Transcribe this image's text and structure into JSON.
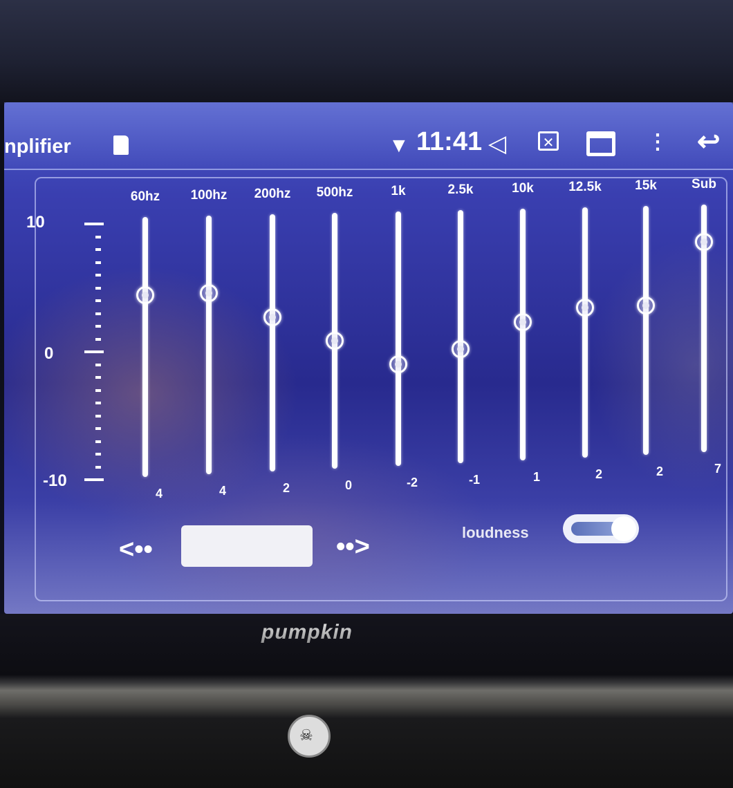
{
  "status_bar": {
    "app_title": "nplifier",
    "clock": "11:41"
  },
  "equalizer": {
    "scale": {
      "max": "10",
      "mid": "0",
      "min": "-10"
    },
    "range": [
      -10,
      10
    ],
    "bands": [
      {
        "label": "60hz",
        "value_text": "4",
        "level": 4
      },
      {
        "label": "100hz",
        "value_text": "4",
        "level": 4
      },
      {
        "label": "200hz",
        "value_text": "2",
        "level": 2
      },
      {
        "label": "500hz",
        "value_text": "0",
        "level": 0
      },
      {
        "label": "1k",
        "value_text": "-2",
        "level": -2
      },
      {
        "label": "2.5k",
        "value_text": "-1",
        "level": -1
      },
      {
        "label": "10k",
        "value_text": "1",
        "level": 1
      },
      {
        "label": "12.5k",
        "value_text": "2",
        "level": 2
      },
      {
        "label": "15k",
        "value_text": "2",
        "level": 2
      },
      {
        "label": "Sub",
        "value_text": "7",
        "level": 7
      }
    ]
  },
  "controls": {
    "prev_preset": "<••",
    "next_preset": "••>",
    "loudness_label": "loudness",
    "loudness_on": true
  },
  "device": {
    "brand": "pumpkin"
  },
  "colors": {
    "screen_blue": "#2e3296",
    "slider_white": "#ffffff"
  }
}
